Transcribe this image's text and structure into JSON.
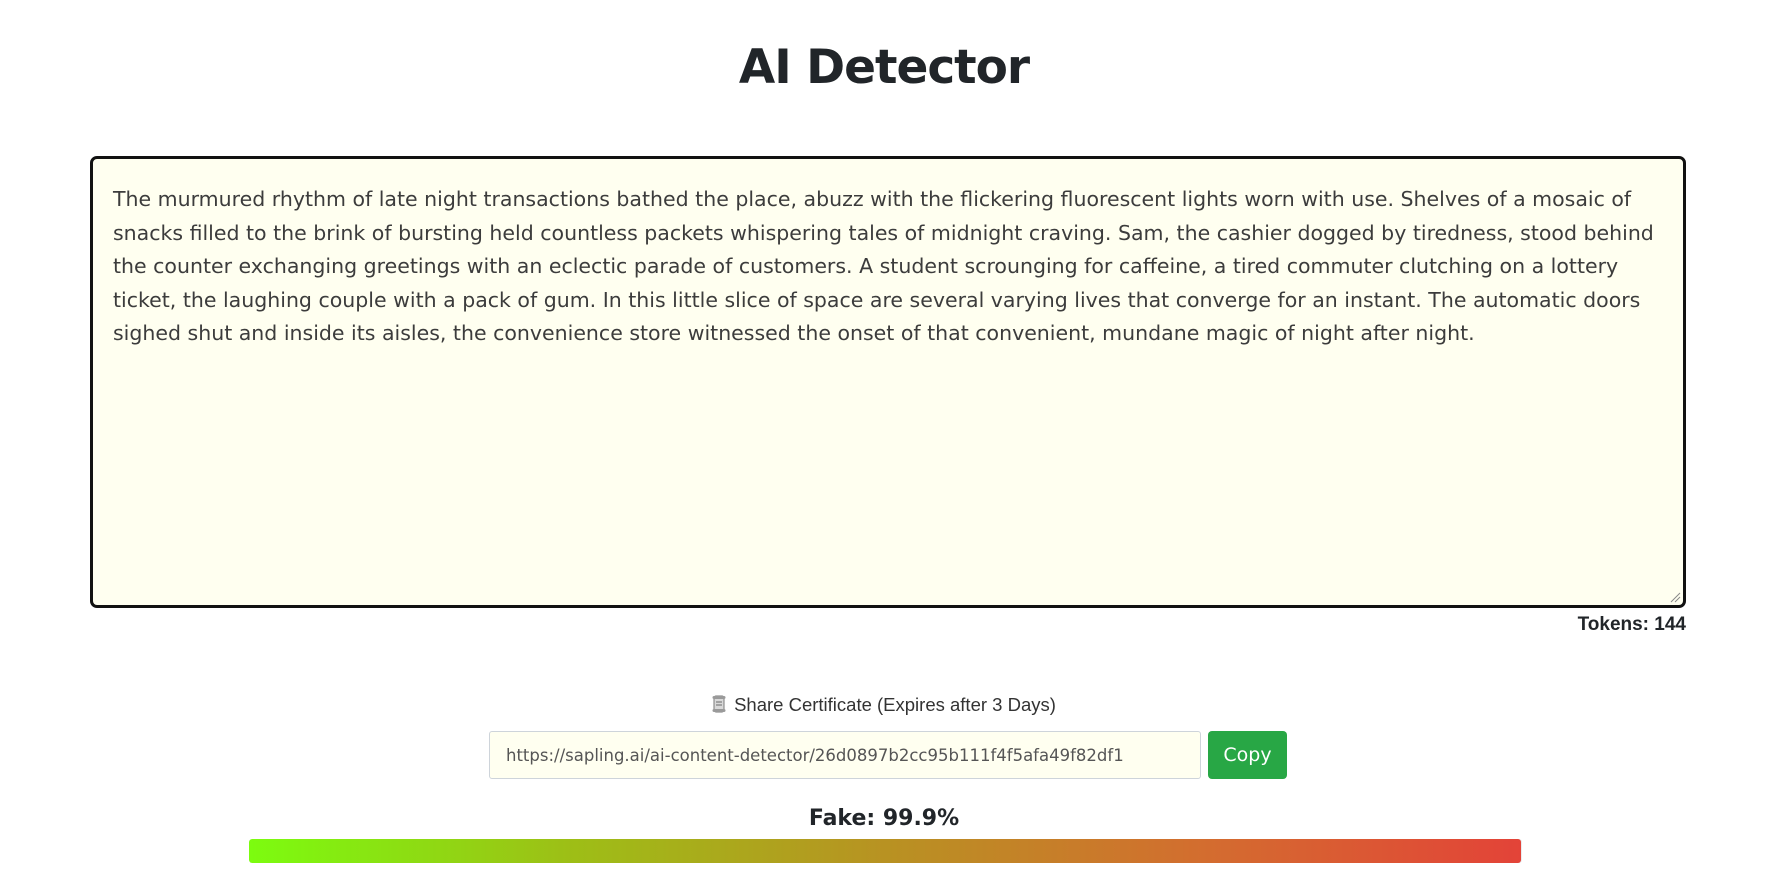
{
  "header": {
    "title": "AI Detector"
  },
  "editor": {
    "text": "The murmured rhythm of late night transactions bathed the place, abuzz with the flickering fluorescent lights worn with use. Shelves of a mosaic of snacks filled to the brink of bursting held countless packets whispering tales of midnight craving. Sam, the cashier dogged by tiredness, stood behind the counter exchanging greetings with an eclectic parade of customers. A student scrounging for caffeine, a tired commuter clutching on a lottery ticket, the laughing couple with a pack of gum. In this little slice of space are several varying lives that converge for an instant. The automatic doors sighed shut and inside its aisles, the convenience store witnessed the onset of that convenient, mundane magic of night after night.",
    "background_color": "#fffff0",
    "token_count": "Tokens: 144"
  },
  "share": {
    "icon": "scroll-icon",
    "label": "Share Certificate (Expires after 3 Days)",
    "url": "https://sapling.ai/ai-content-detector/26d0897b2cc95b111f4f5afa49f82df1",
    "copy_label": "Copy",
    "copy_color": "#28a745"
  },
  "result": {
    "verdict": "Fake: 99.9%",
    "fake_probability": 0.999,
    "gradient_start": "#7cfc0f",
    "gradient_end": "#e34338"
  }
}
